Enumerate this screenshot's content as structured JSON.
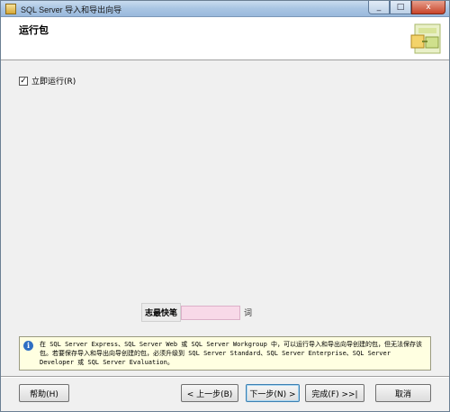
{
  "window": {
    "title": "SQL Server 导入和导出向导",
    "minimize_glyph": "_",
    "maximize_glyph": "□",
    "close_glyph": "x"
  },
  "header": {
    "title": "运行包",
    "graphic_icon": "wizard-banner-icon"
  },
  "options": {
    "run_immediately": {
      "label": "立即运行(R)",
      "checked": true,
      "check_glyph": "✓"
    }
  },
  "hidden_field": {
    "label": "志最快笔",
    "tail": "词"
  },
  "info": {
    "icon_glyph": "i",
    "text": "在 SQL Server Express、SQL Server Web 或 SQL Server Workgroup 中，可以运行导入和导出向导创建的包，但无法保存该包。若要保存导入和导出向导创建的包，必须升级到 SQL Server Standard、SQL Server Enterprise、SQL Server Developer 或 SQL Server Evaluation。"
  },
  "buttons": {
    "help": "帮助(H)",
    "back": "< 上一步(B)",
    "next": "下一步(N) >",
    "finish": "完成(F) >>|",
    "cancel": "取消"
  },
  "colors": {
    "titlebar": "#a9c5e3",
    "dialog_bg": "#f0f0f0",
    "info_bg": "#ffffe1",
    "field_pink": "#f8d9e8"
  }
}
